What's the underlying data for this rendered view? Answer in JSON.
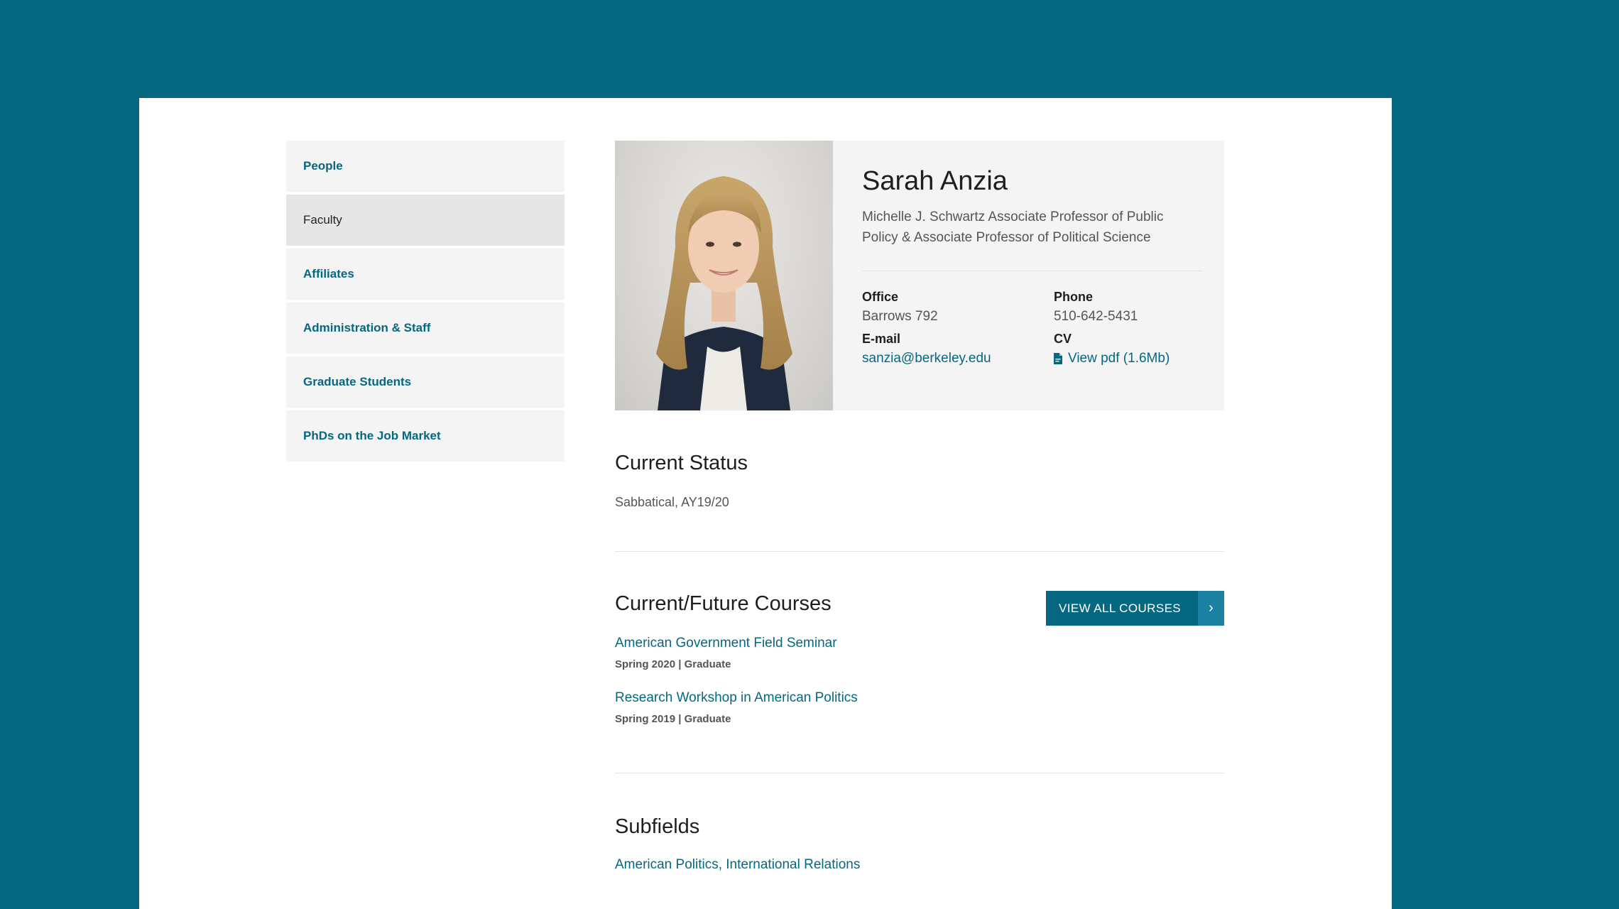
{
  "sidebar": {
    "items": [
      {
        "label": "People"
      },
      {
        "label": "Faculty"
      },
      {
        "label": "Affiliates"
      },
      {
        "label": "Administration & Staff"
      },
      {
        "label": "Graduate Students"
      },
      {
        "label": "PhDs on the Job Market"
      }
    ]
  },
  "profile": {
    "name": "Sarah Anzia",
    "title": "Michelle J. Schwartz Associate Professor of Public Policy & Associate Professor of Political Science",
    "office_label": "Office",
    "office_value": "Barrows 792",
    "phone_label": "Phone",
    "phone_value": "510-642-5431",
    "email_label": "E-mail",
    "email_value": "sanzia@berkeley.edu",
    "cv_label": "CV",
    "cv_link": "View pdf (1.6Mb)",
    "cv_icon": "pdf-file-icon"
  },
  "status": {
    "heading": "Current Status",
    "text": "Sabbatical, AY19/20"
  },
  "courses": {
    "heading": "Current/Future Courses",
    "button_label": "VIEW ALL COURSES",
    "items": [
      {
        "title": "American Government Field Seminar",
        "meta": "Spring 2020 | Graduate"
      },
      {
        "title": "Research Workshop in American Politics",
        "meta": "Spring 2019 | Graduate"
      }
    ]
  },
  "subfields": {
    "heading": "Subfields",
    "text": "American Politics, International Relations"
  },
  "colors": {
    "brand_teal": "#066781",
    "background_teal": "#066781",
    "panel_grey": "#f4f4f4"
  }
}
